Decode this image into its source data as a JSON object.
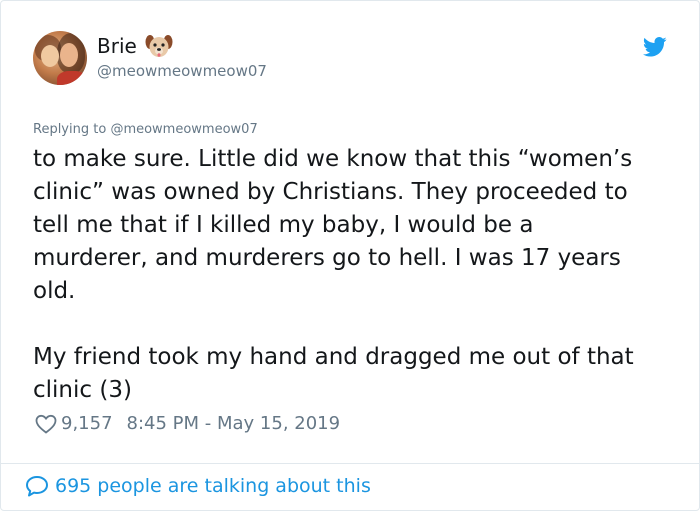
{
  "author": {
    "display_name": "Brie",
    "emoji_icon": "dog-face-icon",
    "handle": "@meowmeowmeow07"
  },
  "header": {
    "platform_icon": "twitter-bird-icon",
    "brand_color": "#1da1f2"
  },
  "replying": {
    "prefix": "Replying to",
    "target": "@meowmeowmeow07"
  },
  "tweet": {
    "text": "to make sure. Little did we know that this “women’s\nclinic” was owned by Christians. They proceeded to\ntell me that if I killed my baby, I would be a\nmurderer, and murderers go to hell. I was 17 years\nold.\n\nMy friend took my hand and dragged me out of that\nclinic (3)"
  },
  "meta": {
    "like_icon": "heart-icon",
    "likes": "9,157",
    "timestamp": "8:45 PM - May 15, 2019"
  },
  "footer": {
    "icon": "speech-bubble-icon",
    "text": "695 people are talking about this",
    "link_color": "#1b95e0"
  }
}
